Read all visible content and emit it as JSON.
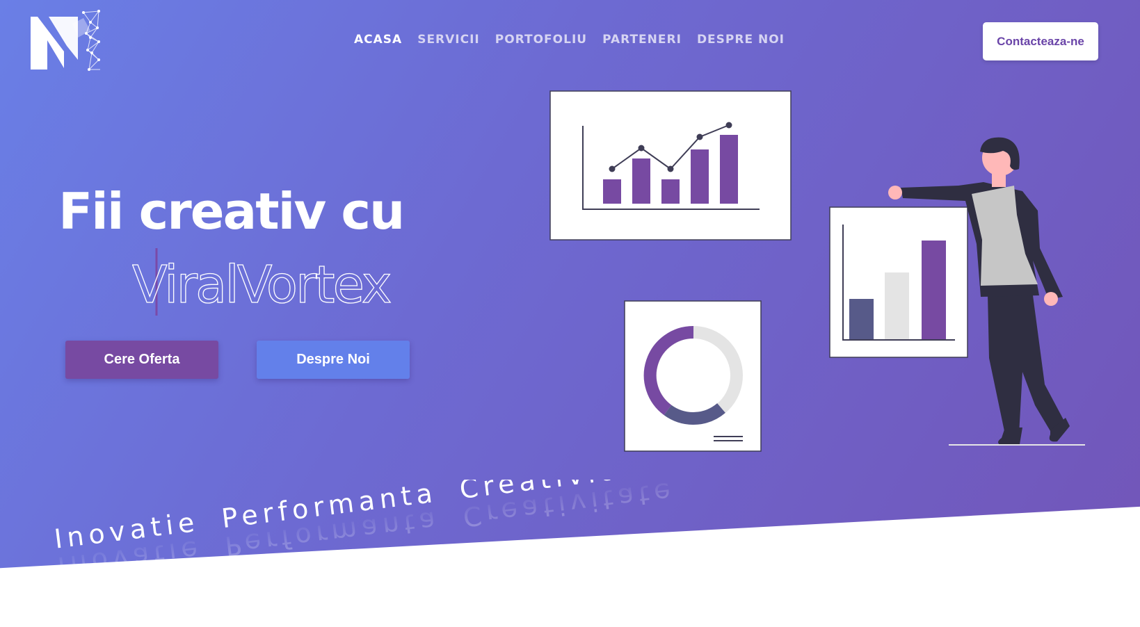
{
  "nav": {
    "items": [
      {
        "label": "ACASA",
        "active": true
      },
      {
        "label": "SERVICII",
        "active": false
      },
      {
        "label": "PORTOFOLIU",
        "active": false
      },
      {
        "label": "PARTENERI",
        "active": false
      },
      {
        "label": "DESPRE NOI",
        "active": false
      }
    ],
    "contact_label": "Contacteaza-ne"
  },
  "hero": {
    "headline": "Fii creativ cu",
    "brand_text": "ViralVortex",
    "buttons": {
      "offer_label": "Cere Oferta",
      "about_label": "Despre Noi"
    },
    "tagline_words": [
      "Inovatie",
      "Performanta",
      "Creativitate"
    ]
  },
  "colors": {
    "gradient_start": "#6a7fe6",
    "gradient_end": "#7255b8",
    "accent_purple": "#774aa2",
    "accent_blue": "#6380ea",
    "white": "#ffffff"
  },
  "icons": {
    "logo": "viralvortex-logo",
    "illustration": "man-presenting-charts"
  }
}
